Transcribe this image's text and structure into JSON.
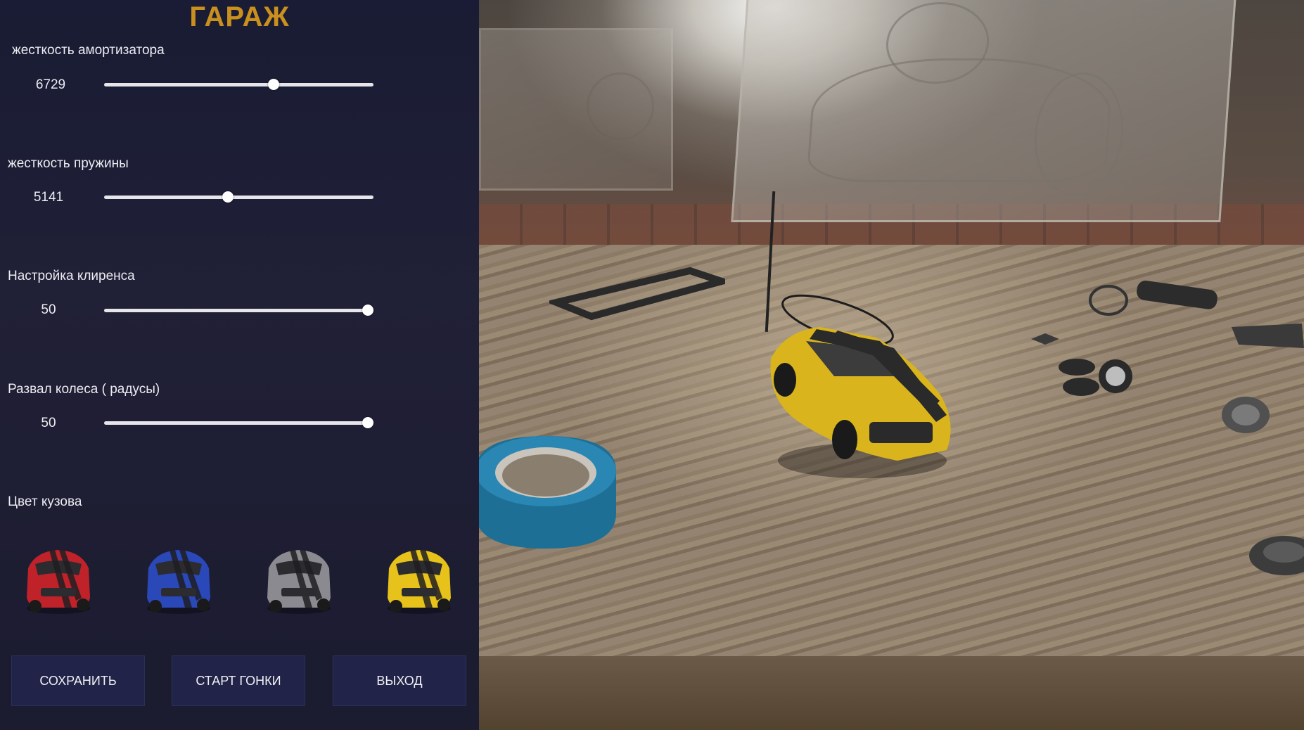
{
  "garage": {
    "title": "ГАРАЖ",
    "accent_color": "#c9901e"
  },
  "settings": [
    {
      "label": "жесткость амортизатора",
      "value": "6729",
      "slider_fraction": 0.63
    },
    {
      "label": "жесткость пружины",
      "value": "5141",
      "slider_fraction": 0.46
    },
    {
      "label": "Настройка клиренса",
      "value": "50",
      "slider_fraction": 0.98
    },
    {
      "label": "Развал  колеса ( радусы)",
      "value": "50",
      "slider_fraction": 0.98
    }
  ],
  "body_color": {
    "label": "Цвет кузова",
    "options": [
      {
        "name": "red",
        "color": "#c0222a"
      },
      {
        "name": "blue",
        "color": "#2a48b8"
      },
      {
        "name": "gray",
        "color": "#8a8a90"
      },
      {
        "name": "yellow",
        "color": "#e6c21a"
      }
    ]
  },
  "buttons": {
    "save": "СОХРАНИТЬ",
    "start": "СТАРТ ГОНКИ",
    "exit": "ВЫХОД"
  },
  "scene": {
    "car_color": "#d9b41c",
    "stripe_color": "#2a2a2a"
  }
}
